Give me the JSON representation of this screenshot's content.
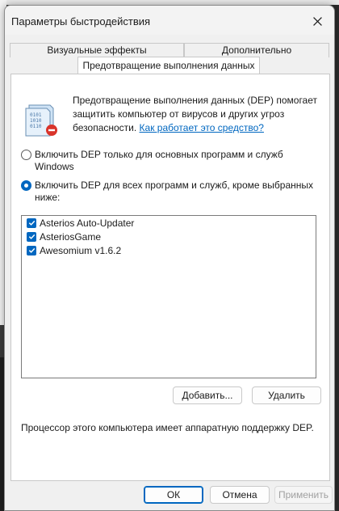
{
  "window": {
    "title": "Параметры быстродействия",
    "close_icon": "close-icon"
  },
  "tabs": {
    "visual": "Визуальные эффекты",
    "advanced": "Дополнительно",
    "active": "Предотвращение выполнения данных"
  },
  "info": {
    "icon": "dep-shield-icon",
    "text": "Предотвращение выполнения данных (DEP) помогает защитить компьютер от вирусов и других угроз безопасности.",
    "link": "Как работает это средство?"
  },
  "options": [
    {
      "label": "Включить DEP только для основных программ и служб Windows",
      "checked": false
    },
    {
      "label": "Включить DEP для всех программ и служб, кроме выбранных ниже:",
      "checked": true
    }
  ],
  "programs": [
    {
      "label": "Asterios Auto-Updater",
      "checked": true
    },
    {
      "label": "AsteriosGame",
      "checked": true
    },
    {
      "label": "Awesomium v1.6.2",
      "checked": true
    }
  ],
  "buttons": {
    "add": "Добавить...",
    "remove": "Удалить",
    "ok": "ОК",
    "cancel": "Отмена",
    "apply": "Применить"
  },
  "hardware_note": "Процессор этого компьютера имеет аппаратную поддержку DEP.",
  "colors": {
    "accent": "#0067c0"
  }
}
